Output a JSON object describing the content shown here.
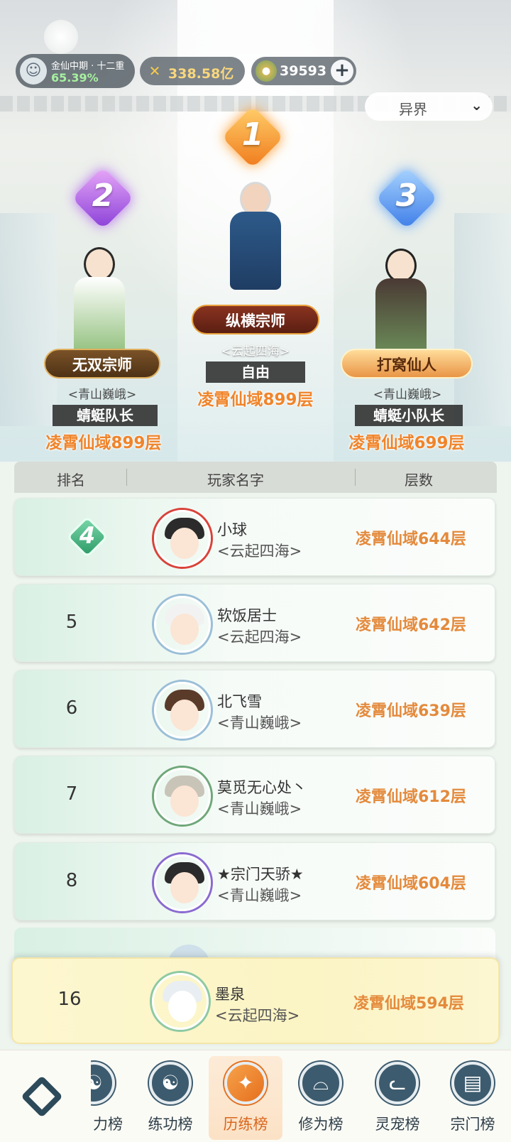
{
  "player": {
    "realm": "金仙中期 · 十二重",
    "progress": "65.39%"
  },
  "currency": {
    "gold": "338.58亿",
    "jade": "39593"
  },
  "realm_filter": {
    "selected": "异界"
  },
  "podium": [
    {
      "rank": "1",
      "title": "纵横宗师",
      "guild": "<云起四海>",
      "name": "自由",
      "floor": "凌霄仙域899层"
    },
    {
      "rank": "2",
      "title": "无双宗师",
      "guild": "<青山巍峨>",
      "name": "蜻蜓队长",
      "floor": "凌霄仙域899层"
    },
    {
      "rank": "3",
      "title": "打窝仙人",
      "guild": "<青山巍峨>",
      "name": "蜻蜓小队长",
      "floor": "凌霄仙域699层"
    }
  ],
  "table": {
    "headers": {
      "rank": "排名",
      "name": "玩家名字",
      "floor": "层数"
    },
    "rows": [
      {
        "rank": "4",
        "name": "小球",
        "guild": "<云起四海>",
        "floor": "凌霄仙域644层"
      },
      {
        "rank": "5",
        "name": "软饭居士",
        "guild": "<云起四海>",
        "floor": "凌霄仙域642层"
      },
      {
        "rank": "6",
        "name": "北飞雪",
        "guild": "<青山巍峨>",
        "floor": "凌霄仙域639层"
      },
      {
        "rank": "7",
        "name": "莫觅无心处丶",
        "guild": "<青山巍峨>",
        "floor": "凌霄仙域612层"
      },
      {
        "rank": "8",
        "name": "★宗门天骄★",
        "guild": "<青山巍峨>",
        "floor": "凌霄仙域604层"
      }
    ]
  },
  "self": {
    "rank": "16",
    "name": "墨泉",
    "guild": "<云起四海>",
    "floor": "凌霄仙域594层"
  },
  "nav": {
    "tabs": [
      {
        "label": "力榜",
        "icon": "partial-icon"
      },
      {
        "label": "练功榜",
        "icon": "yin-yang-icon"
      },
      {
        "label": "历练榜",
        "icon": "sword-star-icon"
      },
      {
        "label": "修为榜",
        "icon": "hat-icon"
      },
      {
        "label": "灵宠榜",
        "icon": "cat-icon"
      },
      {
        "label": "宗门榜",
        "icon": "book-icon"
      }
    ]
  }
}
